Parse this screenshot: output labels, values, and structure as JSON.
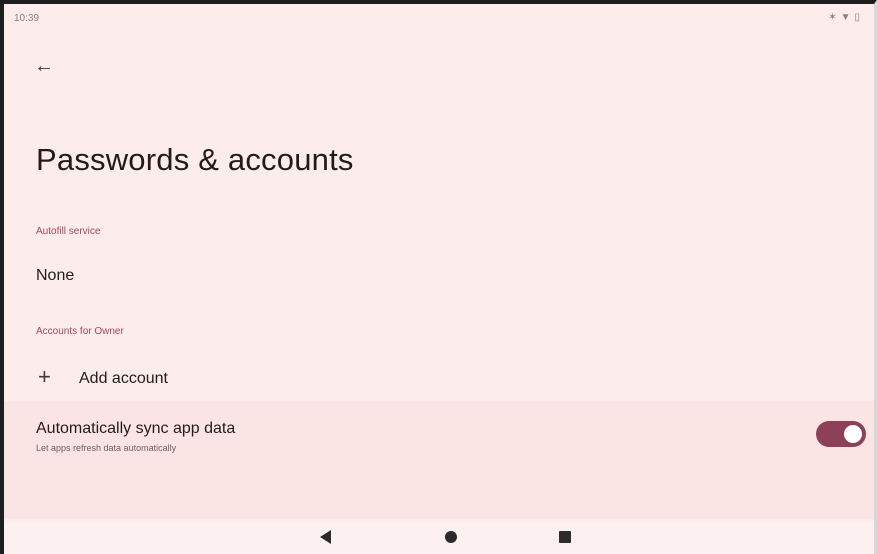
{
  "status_bar": {
    "time": "10:39",
    "icons": [
      "bluetooth-icon",
      "wifi-icon",
      "battery-icon"
    ]
  },
  "header": {
    "back_icon": "arrow-back-icon",
    "title": "Passwords & accounts"
  },
  "autofill": {
    "section_label": "Autofill service",
    "value": "None"
  },
  "accounts": {
    "section_label": "Accounts for Owner",
    "add_label": "Add account"
  },
  "sync": {
    "title": "Automatically sync app data",
    "subtitle": "Let apps refresh data automatically",
    "enabled": true
  },
  "colors": {
    "background": "#fcecec",
    "accent": "#8f4059",
    "section_header": "#9e4a5a"
  },
  "nav_bar": {
    "icons": [
      "nav-back-icon",
      "nav-home-icon",
      "nav-recents-icon"
    ]
  }
}
